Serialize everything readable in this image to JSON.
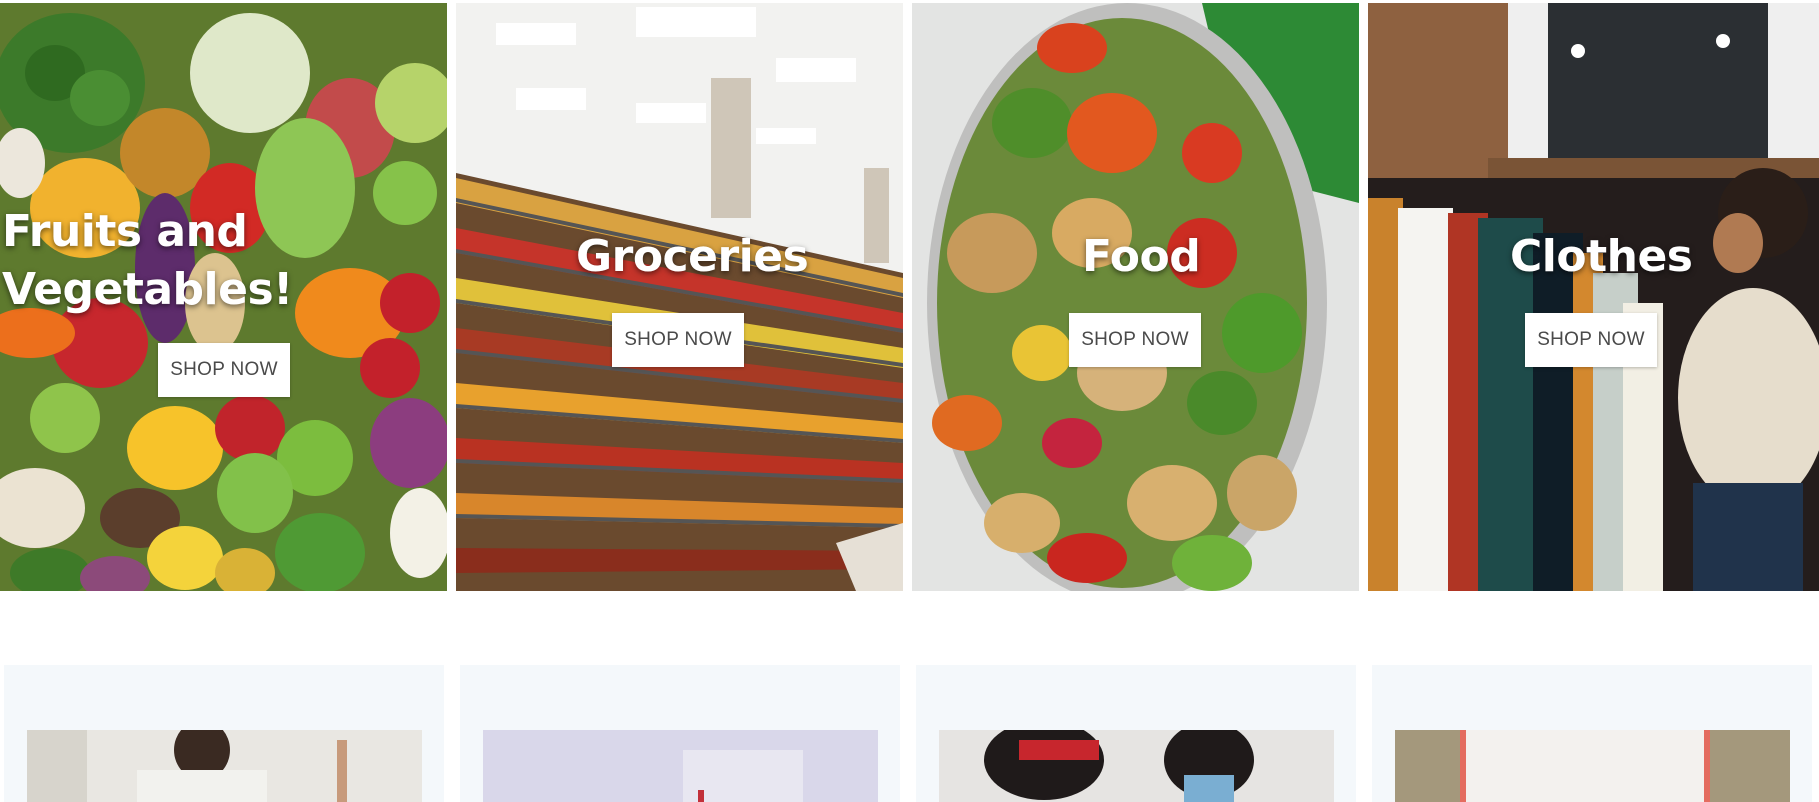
{
  "categories": [
    {
      "title_line1": "Fruits and",
      "title_line2": "Vegetables!",
      "button": "SHOP NOW"
    },
    {
      "title_line1": "Groceries",
      "title_line2": "",
      "button": "SHOP NOW"
    },
    {
      "title_line1": "Food",
      "title_line2": "",
      "button": "SHOP NOW"
    },
    {
      "title_line1": "Clothes",
      "title_line2": "",
      "button": "SHOP NOW"
    }
  ],
  "colors": {
    "button_bg": "#ffffff",
    "button_text": "#4a4a4a",
    "card_bg": "#f4f8fb"
  }
}
